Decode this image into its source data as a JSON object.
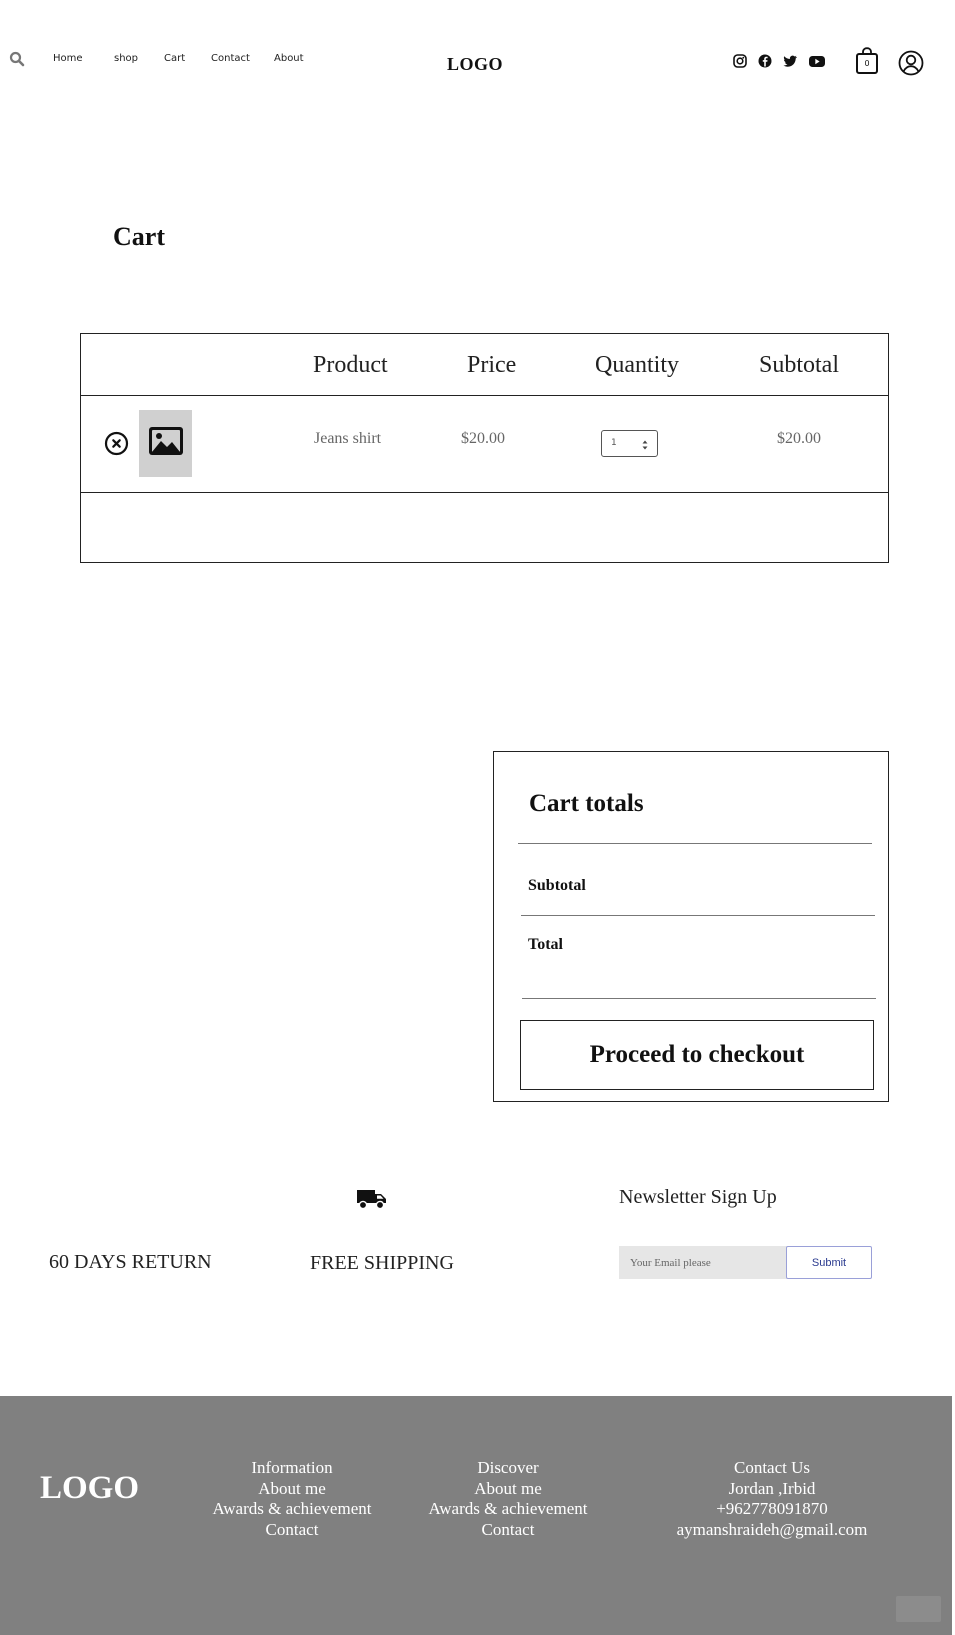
{
  "header": {
    "nav": [
      "Home",
      "shop",
      "Cart",
      "Contact",
      "About"
    ],
    "logo": "LOGO",
    "social_icons": [
      "instagram-icon",
      "facebook-icon",
      "twitter-icon",
      "youtube-icon"
    ],
    "cart_count": "0"
  },
  "cart": {
    "title": "Cart",
    "columns": [
      "Product",
      "Price",
      "Quantity",
      "Subtotal"
    ],
    "items": [
      {
        "name": "Jeans shirt",
        "price": "$20.00",
        "quantity": "1",
        "subtotal": "$20.00"
      }
    ]
  },
  "totals": {
    "title": "Cart totals",
    "subtotal_label": "Subtotal",
    "total_label": "Total",
    "checkout_label": "Proceed to checkout"
  },
  "features": {
    "return_label": "60 DAYS RETURN",
    "shipping_label": "FREE SHIPPING"
  },
  "newsletter": {
    "title": "Newsletter Sign Up",
    "placeholder": "Your Email please",
    "submit_label": "Submit"
  },
  "footer": {
    "logo": "LOGO",
    "information": [
      "Information",
      "About me",
      "Awards & achievement",
      "Contact"
    ],
    "discover": [
      "Discover",
      "About me",
      "Awards & achievement",
      "Contact"
    ],
    "contact": [
      "Contact Us",
      "Jordan ,Irbid",
      "+962778091870",
      "aymanshraideh@gmail.com"
    ]
  },
  "colors": {
    "footer_bg": "#808080",
    "submit_border": "#9aa0d8",
    "submit_text": "#2a3a8f",
    "input_bg": "#e6e6e6"
  }
}
